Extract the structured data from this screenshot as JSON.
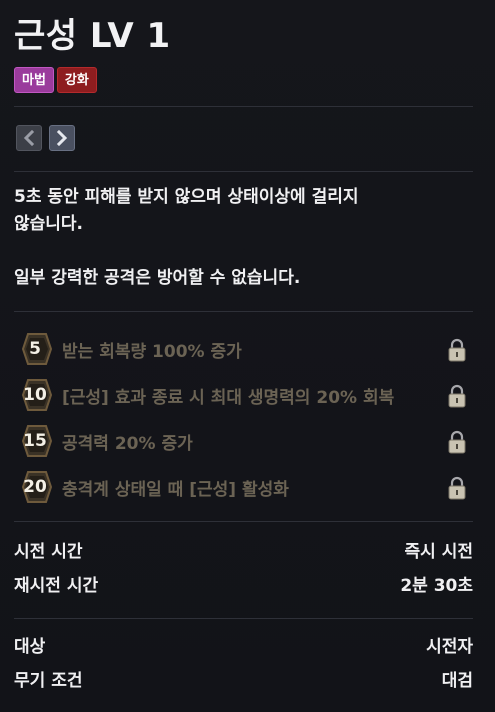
{
  "skill": {
    "name": "근성 LV 1",
    "tags": [
      "마법",
      "강화"
    ]
  },
  "description": {
    "line1": "5초 동안 피해를 받지 않으며 상태이상에 걸리지",
    "line2": "않습니다.",
    "line3": "일부 강력한 공격은 방어할 수 없습니다."
  },
  "tripods": [
    {
      "level": "5",
      "text": "받는 회복량 100% 증가",
      "locked": true
    },
    {
      "level": "10",
      "text": "[근성] 효과 종료 시 최대 생명력의 20% 회복",
      "locked": true
    },
    {
      "level": "15",
      "text": "공격력 20% 증가",
      "locked": true
    },
    {
      "level": "20",
      "text": "충격계 상태일 때 [근성] 활성화",
      "locked": true
    }
  ],
  "info": {
    "cast_time_label": "시전 시간",
    "cast_time_value": "즉시 시전",
    "cooldown_label": "재시전 시간",
    "cooldown_value": "2분 30초",
    "target_label": "대상",
    "target_value": "시전자",
    "weapon_label": "무기 조건",
    "weapon_value": "대검"
  },
  "icons": {
    "prev": "chevron-left-icon",
    "next": "chevron-right-icon",
    "lock": "lock-icon",
    "badge": "tripod-level-badge"
  },
  "colors": {
    "magic_tag": "#9a3b9c",
    "enhance_tag": "#8e1d1f",
    "tripod_text_locked": "#6b6354",
    "background": "#131419"
  }
}
